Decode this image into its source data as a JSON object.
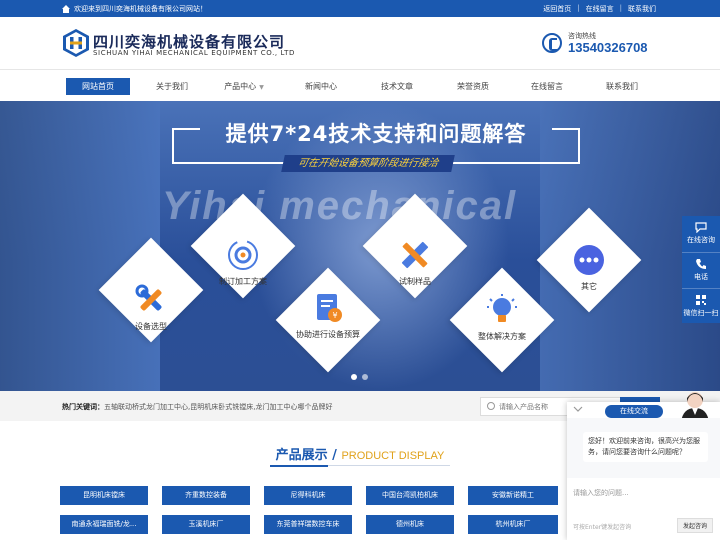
{
  "topbar": {
    "welcome": "欢迎来到四川奕海机械设备有限公司网站！",
    "links": [
      "返回首页",
      "在线留言",
      "联系我们"
    ],
    "separator": "|"
  },
  "header": {
    "company_cn": "四川奕海机械设备有限公司",
    "company_en": "SICHUAN YIHAI MECHANICAL EQUIPMENT CO., LTD",
    "hotline_label": "咨询热线",
    "hotline_number": "13540326708"
  },
  "nav": {
    "items": [
      "网站首页",
      "关于我们",
      "产品中心",
      "新闻中心",
      "技术文章",
      "荣誉资质",
      "在线留言",
      "联系我们"
    ],
    "active": "网站首页"
  },
  "banner": {
    "headline": "提供7*24技术支持和问题解答",
    "subline": "可在开始设备预算阶段进行接洽",
    "watermark": "Yihai mechanical",
    "cards": [
      {
        "label": "设备选型",
        "icon": "tools-icon"
      },
      {
        "label": "制订加工方案",
        "icon": "gear-cycle-icon"
      },
      {
        "label": "协助进行设备预算",
        "icon": "budget-document-icon"
      },
      {
        "label": "试制样品",
        "icon": "ruler-pencil-icon"
      },
      {
        "label": "整体解决方案",
        "icon": "lightbulb-icon"
      },
      {
        "label": "其它",
        "icon": "more-dots-icon"
      }
    ],
    "slides": 2,
    "active_slide": 1
  },
  "search": {
    "hot_label": "热门关键词：",
    "hot_keywords": "五轴联动桥式龙门加工中心,昆明机床卧式铣镗床,龙门加工中心哪个品牌好",
    "placeholder": "请输入产品名称"
  },
  "products_section": {
    "title_cn": "产品展示",
    "divider": "/",
    "title_en": "PRODUCT DISPLAY",
    "row1": [
      "昆明机床镗床",
      "齐重数控装备",
      "尼得科机床",
      "中国台湾凯柏机床",
      "安徽新诺精工"
    ],
    "row2": [
      "南通永福瑞面铣/龙...",
      "玉溪机床厂",
      "东莞普祥瑞数控车床",
      "德州机床",
      "杭州机床厂"
    ]
  },
  "sidebar": {
    "items": [
      {
        "label": "在线咨询",
        "icon": "chat-bubble-icon"
      },
      {
        "label": "电话",
        "icon": "phone-icon"
      },
      {
        "label": "微信扫一扫",
        "icon": "qr-code-icon"
      }
    ]
  },
  "chat": {
    "tab": "在线交流",
    "greeting": "您好！欢迎前来咨询，很高兴为您服务，请问您要咨询什么问题呢？",
    "input_placeholder": "请输入您的问题...",
    "hint": "可按Enter键发起咨询",
    "send_label": "发起咨询"
  },
  "colors": {
    "primary": "#1b59b0",
    "accent": "#e0a21b",
    "subline_text": "#ffd43b"
  }
}
